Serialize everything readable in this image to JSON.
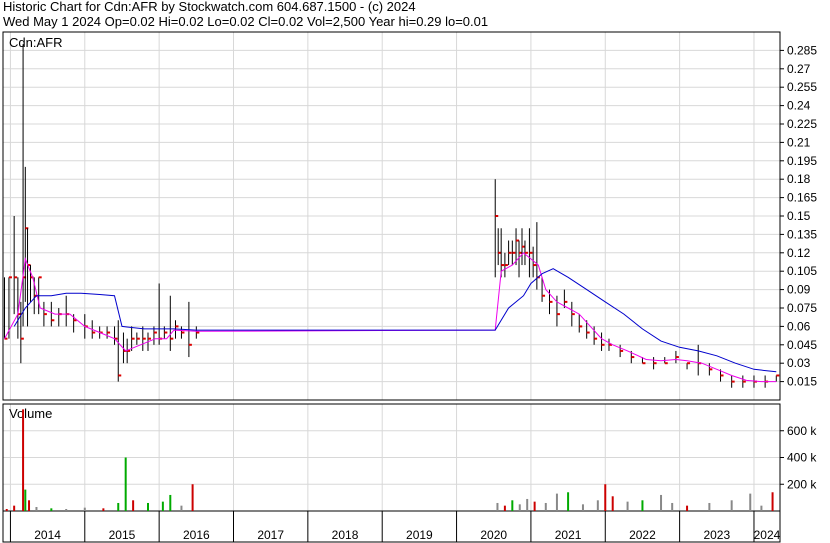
{
  "header": {
    "line1": "Historic Chart for Cdn:AFR by Stockwatch.com 604.687.1500 - (c) 2024",
    "line2": "Wed May  1 2024   Op=0.02  Hi=0.02  Lo=0.02  Cl=0.02  Vol=2,500  Year hi=0.29  lo=0.01"
  },
  "chart_data": {
    "type": "ohlc",
    "symbol_label": "Cdn:AFR",
    "volume_label": "Volume",
    "price_axis": {
      "ticks": [
        0.015,
        0.03,
        0.045,
        0.06,
        0.075,
        0.09,
        0.105,
        0.12,
        0.135,
        0.15,
        0.165,
        0.18,
        0.195,
        0.21,
        0.225,
        0.24,
        0.255,
        0.27,
        0.285
      ],
      "tick_labels": [
        "0.015",
        "0.03",
        "0.045",
        "0.06",
        "0.075",
        "0.09",
        "0.105",
        "0.12",
        "0.135",
        "0.15",
        "0.165",
        "0.18",
        "0.195",
        "0.21",
        "0.225",
        "0.24",
        "0.255",
        "0.27",
        "0.285"
      ],
      "ylim": [
        0.0,
        0.3
      ]
    },
    "volume_axis": {
      "ticks": [
        200000,
        400000,
        600000
      ],
      "tick_labels": [
        "200 k",
        "400 k",
        "600 k"
      ],
      "ylim": [
        0,
        800000
      ]
    },
    "x_axis": {
      "years": [
        "2014",
        "2015",
        "2016",
        "2017",
        "2018",
        "2019",
        "2020",
        "2021",
        "2022",
        "2023",
        "2024"
      ],
      "xlim": [
        2013.9,
        2024.35
      ]
    },
    "series": [
      {
        "name": "price",
        "color": "#000000",
        "close_color": "#dd0000",
        "points": [
          [
            2013.92,
            0.1,
            0.05,
            0.05
          ],
          [
            2013.98,
            0.1,
            0.05,
            0.1
          ],
          [
            2014.05,
            0.15,
            0.07,
            0.1
          ],
          [
            2014.1,
            0.1,
            0.05,
            0.07
          ],
          [
            2014.14,
            0.08,
            0.03,
            0.05
          ],
          [
            2014.17,
            0.29,
            0.06,
            0.1
          ],
          [
            2014.2,
            0.19,
            0.08,
            0.14
          ],
          [
            2014.23,
            0.14,
            0.06,
            0.11
          ],
          [
            2014.27,
            0.11,
            0.08,
            0.1
          ],
          [
            2014.32,
            0.1,
            0.07,
            0.085
          ],
          [
            2014.38,
            0.1,
            0.07,
            0.1
          ],
          [
            2014.45,
            0.08,
            0.06,
            0.07
          ],
          [
            2014.55,
            0.08,
            0.06,
            0.065
          ],
          [
            2014.65,
            0.075,
            0.06,
            0.07
          ],
          [
            2014.75,
            0.085,
            0.06,
            0.07
          ],
          [
            2014.85,
            0.07,
            0.055,
            0.065
          ],
          [
            2015.0,
            0.07,
            0.05,
            0.06
          ],
          [
            2015.1,
            0.065,
            0.05,
            0.055
          ],
          [
            2015.2,
            0.06,
            0.05,
            0.055
          ],
          [
            2015.3,
            0.06,
            0.05,
            0.055
          ],
          [
            2015.4,
            0.06,
            0.045,
            0.05
          ],
          [
            2015.45,
            0.065,
            0.015,
            0.02
          ],
          [
            2015.52,
            0.055,
            0.03,
            0.04
          ],
          [
            2015.57,
            0.05,
            0.03,
            0.04
          ],
          [
            2015.63,
            0.06,
            0.04,
            0.05
          ],
          [
            2015.7,
            0.055,
            0.045,
            0.05
          ],
          [
            2015.78,
            0.06,
            0.04,
            0.05
          ],
          [
            2015.85,
            0.055,
            0.04,
            0.05
          ],
          [
            2015.93,
            0.06,
            0.045,
            0.055
          ],
          [
            2016.0,
            0.095,
            0.045,
            0.05
          ],
          [
            2016.07,
            0.06,
            0.05,
            0.055
          ],
          [
            2016.15,
            0.085,
            0.04,
            0.05
          ],
          [
            2016.22,
            0.065,
            0.05,
            0.06
          ],
          [
            2016.3,
            0.06,
            0.05,
            0.055
          ],
          [
            2016.4,
            0.08,
            0.035,
            0.045
          ],
          [
            2016.5,
            0.06,
            0.05,
            0.055
          ],
          [
            2020.52,
            0.18,
            0.1,
            0.15
          ],
          [
            2020.56,
            0.14,
            0.11,
            0.12
          ],
          [
            2020.6,
            0.14,
            0.1,
            0.11
          ],
          [
            2020.65,
            0.12,
            0.1,
            0.11
          ],
          [
            2020.7,
            0.13,
            0.11,
            0.12
          ],
          [
            2020.75,
            0.13,
            0.11,
            0.12
          ],
          [
            2020.8,
            0.14,
            0.11,
            0.13
          ],
          [
            2020.84,
            0.13,
            0.1,
            0.12
          ],
          [
            2020.88,
            0.14,
            0.11,
            0.125
          ],
          [
            2020.92,
            0.13,
            0.11,
            0.12
          ],
          [
            2020.98,
            0.14,
            0.1,
            0.12
          ],
          [
            2021.03,
            0.125,
            0.1,
            0.11
          ],
          [
            2021.08,
            0.145,
            0.09,
            0.1
          ],
          [
            2021.15,
            0.1,
            0.08,
            0.085
          ],
          [
            2021.25,
            0.09,
            0.07,
            0.08
          ],
          [
            2021.35,
            0.085,
            0.06,
            0.07
          ],
          [
            2021.45,
            0.09,
            0.075,
            0.08
          ],
          [
            2021.55,
            0.08,
            0.06,
            0.07
          ],
          [
            2021.65,
            0.07,
            0.055,
            0.06
          ],
          [
            2021.75,
            0.065,
            0.05,
            0.055
          ],
          [
            2021.85,
            0.06,
            0.045,
            0.05
          ],
          [
            2021.95,
            0.055,
            0.04,
            0.045
          ],
          [
            2022.05,
            0.05,
            0.04,
            0.045
          ],
          [
            2022.2,
            0.045,
            0.035,
            0.04
          ],
          [
            2022.35,
            0.04,
            0.03,
            0.035
          ],
          [
            2022.5,
            0.035,
            0.03,
            0.03
          ],
          [
            2022.65,
            0.035,
            0.025,
            0.03
          ],
          [
            2022.8,
            0.035,
            0.03,
            0.03
          ],
          [
            2022.95,
            0.04,
            0.03,
            0.035
          ],
          [
            2023.1,
            0.03,
            0.025,
            0.03
          ],
          [
            2023.25,
            0.045,
            0.02,
            0.03
          ],
          [
            2023.4,
            0.03,
            0.02,
            0.025
          ],
          [
            2023.55,
            0.025,
            0.015,
            0.02
          ],
          [
            2023.7,
            0.02,
            0.01,
            0.015
          ],
          [
            2023.85,
            0.02,
            0.01,
            0.015
          ],
          [
            2024.0,
            0.02,
            0.01,
            0.015
          ],
          [
            2024.15,
            0.02,
            0.01,
            0.015
          ],
          [
            2024.3,
            0.02,
            0.015,
            0.02
          ]
        ]
      },
      {
        "name": "ma-short",
        "color": "#ee00ee",
        "points": [
          [
            2013.92,
            0.05
          ],
          [
            2014.1,
            0.07
          ],
          [
            2014.2,
            0.115
          ],
          [
            2014.3,
            0.1
          ],
          [
            2014.4,
            0.075
          ],
          [
            2014.6,
            0.07
          ],
          [
            2014.8,
            0.07
          ],
          [
            2015.0,
            0.06
          ],
          [
            2015.2,
            0.055
          ],
          [
            2015.4,
            0.05
          ],
          [
            2015.55,
            0.04
          ],
          [
            2015.75,
            0.045
          ],
          [
            2015.95,
            0.05
          ],
          [
            2016.1,
            0.05
          ],
          [
            2016.2,
            0.057
          ],
          [
            2016.5,
            0.056
          ],
          [
            2020.52,
            0.057
          ],
          [
            2020.6,
            0.105
          ],
          [
            2020.75,
            0.11
          ],
          [
            2020.9,
            0.12
          ],
          [
            2021.0,
            0.115
          ],
          [
            2021.1,
            0.11
          ],
          [
            2021.2,
            0.09
          ],
          [
            2021.35,
            0.08
          ],
          [
            2021.5,
            0.075
          ],
          [
            2021.65,
            0.07
          ],
          [
            2021.8,
            0.06
          ],
          [
            2021.95,
            0.05
          ],
          [
            2022.1,
            0.045
          ],
          [
            2022.3,
            0.04
          ],
          [
            2022.55,
            0.033
          ],
          [
            2022.75,
            0.032
          ],
          [
            2022.95,
            0.033
          ],
          [
            2023.1,
            0.032
          ],
          [
            2023.3,
            0.03
          ],
          [
            2023.5,
            0.025
          ],
          [
            2023.7,
            0.02
          ],
          [
            2023.9,
            0.016
          ],
          [
            2024.1,
            0.015
          ],
          [
            2024.3,
            0.015
          ]
        ]
      },
      {
        "name": "ma-long",
        "color": "#0000cc",
        "points": [
          [
            2014.05,
            0.06
          ],
          [
            2014.2,
            0.075
          ],
          [
            2014.35,
            0.085
          ],
          [
            2014.55,
            0.085
          ],
          [
            2014.75,
            0.087
          ],
          [
            2014.95,
            0.087
          ],
          [
            2015.2,
            0.086
          ],
          [
            2015.4,
            0.085
          ],
          [
            2015.5,
            0.06
          ],
          [
            2015.8,
            0.058
          ],
          [
            2016.2,
            0.058
          ],
          [
            2016.5,
            0.057
          ],
          [
            2020.52,
            0.057
          ],
          [
            2020.7,
            0.075
          ],
          [
            2020.9,
            0.085
          ],
          [
            2021.0,
            0.095
          ],
          [
            2021.15,
            0.103
          ],
          [
            2021.3,
            0.107
          ],
          [
            2021.5,
            0.1
          ],
          [
            2021.75,
            0.09
          ],
          [
            2022.0,
            0.08
          ],
          [
            2022.25,
            0.07
          ],
          [
            2022.5,
            0.058
          ],
          [
            2022.75,
            0.048
          ],
          [
            2023.0,
            0.043
          ],
          [
            2023.25,
            0.04
          ],
          [
            2023.5,
            0.036
          ],
          [
            2023.75,
            0.03
          ],
          [
            2024.0,
            0.025
          ],
          [
            2024.3,
            0.023
          ]
        ]
      }
    ],
    "volume": [
      [
        2013.95,
        15000,
        "#cc0000"
      ],
      [
        2014.05,
        40000,
        "#cc0000"
      ],
      [
        2014.17,
        760000,
        "#cc0000"
      ],
      [
        2014.2,
        160000,
        "#00aa00"
      ],
      [
        2014.25,
        80000,
        "#cc0000"
      ],
      [
        2014.35,
        30000,
        "#888888"
      ],
      [
        2014.55,
        20000,
        "#00aa00"
      ],
      [
        2014.75,
        15000,
        "#888888"
      ],
      [
        2015.0,
        25000,
        "#888888"
      ],
      [
        2015.25,
        20000,
        "#cc0000"
      ],
      [
        2015.45,
        60000,
        "#00aa00"
      ],
      [
        2015.55,
        400000,
        "#00aa00"
      ],
      [
        2015.65,
        80000,
        "#cc0000"
      ],
      [
        2015.85,
        60000,
        "#00aa00"
      ],
      [
        2016.05,
        70000,
        "#00aa00"
      ],
      [
        2016.15,
        120000,
        "#00aa00"
      ],
      [
        2016.3,
        40000,
        "#888888"
      ],
      [
        2016.45,
        200000,
        "#cc0000"
      ],
      [
        2020.55,
        60000,
        "#888888"
      ],
      [
        2020.65,
        40000,
        "#cc0000"
      ],
      [
        2020.75,
        80000,
        "#00aa00"
      ],
      [
        2020.85,
        50000,
        "#888888"
      ],
      [
        2020.95,
        90000,
        "#888888"
      ],
      [
        2021.05,
        70000,
        "#cc0000"
      ],
      [
        2021.2,
        60000,
        "#888888"
      ],
      [
        2021.35,
        130000,
        "#888888"
      ],
      [
        2021.5,
        140000,
        "#00aa00"
      ],
      [
        2021.7,
        50000,
        "#888888"
      ],
      [
        2021.9,
        80000,
        "#888888"
      ],
      [
        2022.0,
        200000,
        "#cc0000"
      ],
      [
        2022.1,
        110000,
        "#cc0000"
      ],
      [
        2022.3,
        70000,
        "#888888"
      ],
      [
        2022.5,
        80000,
        "#00aa00"
      ],
      [
        2022.75,
        120000,
        "#888888"
      ],
      [
        2022.9,
        60000,
        "#888888"
      ],
      [
        2023.1,
        40000,
        "#cc0000"
      ],
      [
        2023.4,
        60000,
        "#888888"
      ],
      [
        2023.7,
        80000,
        "#888888"
      ],
      [
        2023.95,
        130000,
        "#888888"
      ],
      [
        2024.1,
        40000,
        "#888888"
      ],
      [
        2024.25,
        140000,
        "#cc0000"
      ]
    ]
  }
}
